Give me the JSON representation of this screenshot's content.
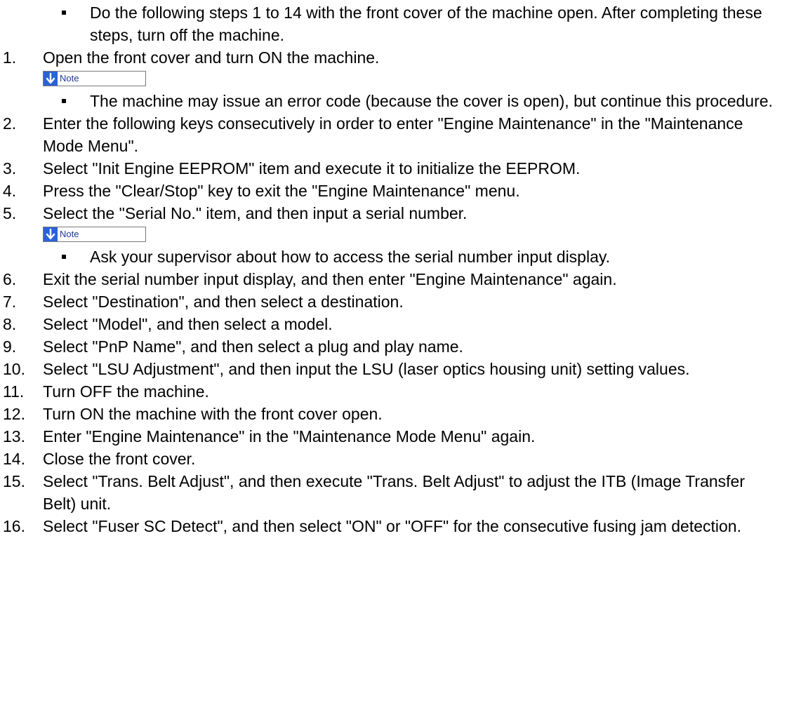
{
  "intro_bullet": "Do the following steps 1 to 14 with the front cover of the machine open. After completing these steps, turn off the machine.",
  "note_label": "Note",
  "colors": {
    "note_icon_bg": "#2b62d9",
    "note_border": "#7a7a7a",
    "text": "#000000"
  },
  "steps": [
    {
      "num": "1.",
      "text": "Open the front cover and turn ON the machine."
    },
    {
      "num": "2.",
      "text": "Enter the following keys consecutively in order to enter \"Engine Maintenance\" in the \"Maintenance Mode Menu\"."
    },
    {
      "num": "3.",
      "text": "Select \"Init Engine EEPROM\" item and execute it to initialize the EEPROM."
    },
    {
      "num": "4.",
      "text": "Press the \"Clear/Stop\" key to exit the \"Engine Maintenance\" menu."
    },
    {
      "num": "5.",
      "text": "Select the \"Serial No.\" item, and then input a serial number."
    },
    {
      "num": "6.",
      "text": "Exit the serial number input display, and then enter \"Engine Maintenance\" again."
    },
    {
      "num": "7.",
      "text": "Select \"Destination\", and then select a destination."
    },
    {
      "num": "8.",
      "text": "Select \"Model\", and then select a model."
    },
    {
      "num": "9.",
      "text": "Select \"PnP Name\", and then select a plug and play name."
    },
    {
      "num": "10.",
      "text": "Select \"LSU Adjustment\", and then input the LSU (laser optics housing unit) setting values."
    },
    {
      "num": "11.",
      "text": "Turn OFF the machine."
    },
    {
      "num": "12.",
      "text": "Turn ON the machine with the front cover open."
    },
    {
      "num": "13.",
      "text": "Enter \"Engine Maintenance\" in the \"Maintenance Mode Menu\" again."
    },
    {
      "num": "14.",
      "text": "Close the front cover."
    },
    {
      "num": "15.",
      "text": "Select \"Trans. Belt Adjust\", and then execute \"Trans. Belt Adjust\" to adjust the ITB (Image Transfer Belt) unit."
    },
    {
      "num": "16.",
      "text": "Select \"Fuser SC Detect\", and then select \"ON\" or \"OFF\" for the consecutive fusing jam detection."
    }
  ],
  "notes": {
    "step1": "The machine may issue an error code (because the cover is open), but continue this procedure.",
    "step5": "Ask your supervisor about how to access the serial number input display."
  }
}
